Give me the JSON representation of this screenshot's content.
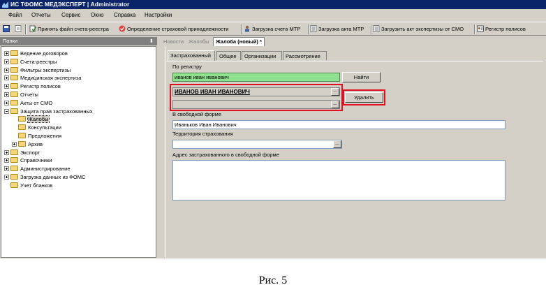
{
  "window": {
    "title": "ИС ТФОМС МЕДЭКСПЕРТ | Administrator"
  },
  "menu": [
    "Файл",
    "Отчеты",
    "Сервис",
    "Окно",
    "Справка",
    "Настройки"
  ],
  "toolbar": {
    "accept_invoice": "Принять файл счета-реестра",
    "insurance_affiliation": "Определение страховой принадлежности",
    "load_mtr_invoice": "Загрузка счета МТР",
    "load_mtr_act": "Загрузка акта МТР",
    "load_smo_act": "Загрузить акт экспертизы от СМО",
    "policy_register": "Регистр полисов"
  },
  "left_panel": {
    "title": "Папки",
    "pin_icon": "pin-icon",
    "tree": [
      {
        "label": "Ведение договоров",
        "level": 0,
        "expander": "plus"
      },
      {
        "label": "Счета-реестры",
        "level": 0,
        "expander": "plus"
      },
      {
        "label": "Фильтры экспертизы",
        "level": 0,
        "expander": "plus"
      },
      {
        "label": "Медицинская экспертиза",
        "level": 0,
        "expander": "plus"
      },
      {
        "label": "Регистр полисов",
        "level": 0,
        "expander": "plus"
      },
      {
        "label": "Отчеты",
        "level": 0,
        "expander": "plus"
      },
      {
        "label": "Акты от СМО",
        "level": 0,
        "expander": "plus"
      },
      {
        "label": "Защита прав застрахованных",
        "level": 0,
        "expander": "minus"
      },
      {
        "label": "Жалобы",
        "level": 1,
        "expander": "none",
        "selected": true
      },
      {
        "label": "Консультации",
        "level": 1,
        "expander": "none"
      },
      {
        "label": "Предложения",
        "level": 1,
        "expander": "none"
      },
      {
        "label": "Архив",
        "level": 1,
        "expander": "plus"
      },
      {
        "label": "Экспорт",
        "level": 0,
        "expander": "plus"
      },
      {
        "label": "Справочники",
        "level": 0,
        "expander": "plus"
      },
      {
        "label": "Администрирование",
        "level": 0,
        "expander": "plus"
      },
      {
        "label": "Загрузка данных из ФОМС",
        "level": 0,
        "expander": "plus"
      },
      {
        "label": "Учет бланков",
        "level": 0,
        "expander": "none"
      }
    ]
  },
  "doc_tabs": [
    "Новости",
    "Жалобы",
    "Жалоба (новый) *"
  ],
  "inner_tabs": [
    "Застрахованный",
    "Общее",
    "Организации",
    "Рассмотрение"
  ],
  "form": {
    "by_register_label": "По регистру",
    "search_value": "иванов иван иванович",
    "find_button": "Найти",
    "found_person": "ИВАНОВ ИВАН ИВАНОВИЧ",
    "found_person_2": "",
    "delete_button": "Удалить",
    "free_form_label": "В свободной форме",
    "free_form_value": "Иваньков Иван Иванович",
    "territory_label": "Территория страхования",
    "territory_value": "",
    "address_label": "Адрес застрахованного в свободной форме",
    "address_value": "",
    "ellipsis": "..."
  },
  "caption": "Рис. 5",
  "colors": {
    "title_bg": "#0a246a",
    "highlight_red": "#e01020",
    "search_green": "#8fe08f"
  }
}
